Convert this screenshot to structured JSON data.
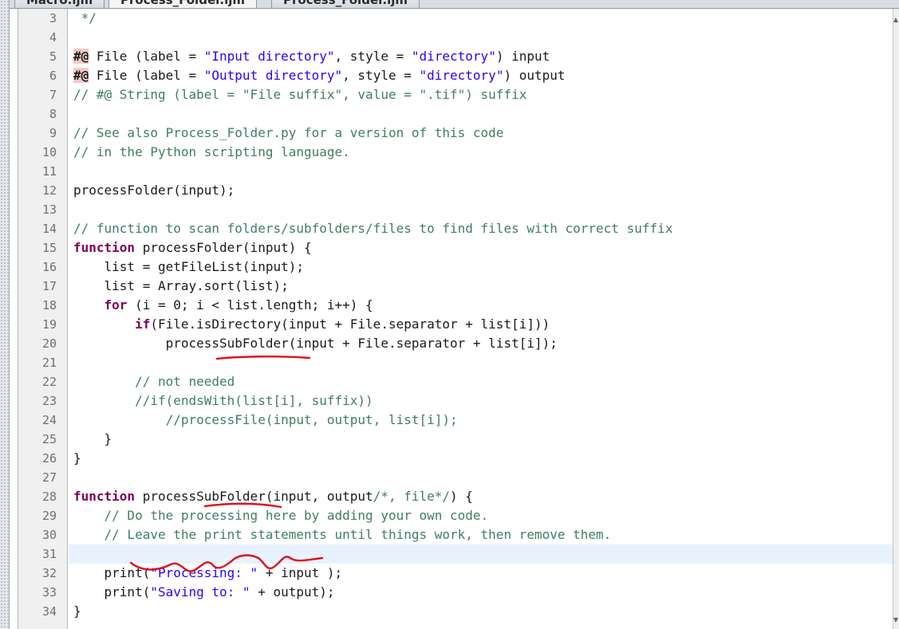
{
  "tabs": [
    {
      "label": "Macro.ijm",
      "active": false
    },
    {
      "label": "Process_Folder.ijm",
      "active": true
    },
    {
      "label": "Process_Folder.ijm",
      "active": false
    }
  ],
  "editor": {
    "current_line": 31,
    "lines": [
      {
        "n": "3",
        "tokens": [
          {
            "t": " */",
            "c": "cmt"
          }
        ]
      },
      {
        "n": "4",
        "tokens": []
      },
      {
        "n": "5",
        "tokens": [
          {
            "t": "#@",
            "c": "ann"
          },
          {
            "t": " File (label = ",
            "c": "txt"
          },
          {
            "t": "\"Input directory\"",
            "c": "str"
          },
          {
            "t": ", style = ",
            "c": "txt"
          },
          {
            "t": "\"directory\"",
            "c": "str"
          },
          {
            "t": ") input",
            "c": "txt"
          }
        ]
      },
      {
        "n": "6",
        "tokens": [
          {
            "t": "#@",
            "c": "ann"
          },
          {
            "t": " File (label = ",
            "c": "txt"
          },
          {
            "t": "\"Output directory\"",
            "c": "str"
          },
          {
            "t": ", style = ",
            "c": "txt"
          },
          {
            "t": "\"directory\"",
            "c": "str"
          },
          {
            "t": ") output",
            "c": "txt"
          }
        ]
      },
      {
        "n": "7",
        "tokens": [
          {
            "t": "// #@ String (label = \"File suffix\", value = \".tif\") suffix",
            "c": "cmt"
          }
        ]
      },
      {
        "n": "8",
        "tokens": []
      },
      {
        "n": "9",
        "tokens": [
          {
            "t": "// See also Process_Folder.py for a version of this code",
            "c": "cmt"
          }
        ]
      },
      {
        "n": "10",
        "tokens": [
          {
            "t": "// in the Python scripting language.",
            "c": "cmt"
          }
        ]
      },
      {
        "n": "11",
        "tokens": []
      },
      {
        "n": "12",
        "tokens": [
          {
            "t": "processFolder(input);",
            "c": "txt"
          }
        ]
      },
      {
        "n": "13",
        "tokens": []
      },
      {
        "n": "14",
        "tokens": [
          {
            "t": "// function to scan folders/subfolders/files to find files with correct suffix",
            "c": "cmt"
          }
        ]
      },
      {
        "n": "15",
        "tokens": [
          {
            "t": "function",
            "c": "kw"
          },
          {
            "t": " processFolder(input) {",
            "c": "txt"
          }
        ]
      },
      {
        "n": "16",
        "tokens": [
          {
            "t": "    list = getFileList(input);",
            "c": "txt"
          }
        ]
      },
      {
        "n": "17",
        "tokens": [
          {
            "t": "    list = Array.sort(list);",
            "c": "txt"
          }
        ]
      },
      {
        "n": "18",
        "tokens": [
          {
            "t": "    ",
            "c": "txt"
          },
          {
            "t": "for",
            "c": "kw"
          },
          {
            "t": " (i = 0; i < list.length; i++) {",
            "c": "txt"
          }
        ]
      },
      {
        "n": "19",
        "tokens": [
          {
            "t": "        ",
            "c": "txt"
          },
          {
            "t": "if",
            "c": "kw"
          },
          {
            "t": "(File.isDirectory(input + File.separator + list[i]))",
            "c": "txt"
          }
        ]
      },
      {
        "n": "20",
        "tokens": [
          {
            "t": "            processSubFolder(input + File.separator + list[i]);",
            "c": "txt"
          }
        ]
      },
      {
        "n": "21",
        "tokens": []
      },
      {
        "n": "22",
        "tokens": [
          {
            "t": "        // not needed",
            "c": "cmt"
          }
        ]
      },
      {
        "n": "23",
        "tokens": [
          {
            "t": "        //if(endsWith(list[i], suffix))",
            "c": "cmt"
          }
        ]
      },
      {
        "n": "24",
        "tokens": [
          {
            "t": "            //processFile(input, output, list[i]);",
            "c": "cmt"
          }
        ]
      },
      {
        "n": "25",
        "tokens": [
          {
            "t": "    }",
            "c": "txt"
          }
        ]
      },
      {
        "n": "26",
        "tokens": [
          {
            "t": "}",
            "c": "txt"
          }
        ]
      },
      {
        "n": "27",
        "tokens": []
      },
      {
        "n": "28",
        "tokens": [
          {
            "t": "function",
            "c": "kw"
          },
          {
            "t": " processSubFolder(input, output",
            "c": "txt"
          },
          {
            "t": "/*, file*/",
            "c": "cmt"
          },
          {
            "t": ") {",
            "c": "txt"
          }
        ]
      },
      {
        "n": "29",
        "tokens": [
          {
            "t": "    // Do the processing here by adding your own code.",
            "c": "cmt"
          }
        ]
      },
      {
        "n": "30",
        "tokens": [
          {
            "t": "    // Leave the print statements until things work, then remove them.",
            "c": "cmt"
          }
        ]
      },
      {
        "n": "31",
        "tokens": []
      },
      {
        "n": "32",
        "tokens": [
          {
            "t": "    print(",
            "c": "txt"
          },
          {
            "t": "\"Processing: \"",
            "c": "str"
          },
          {
            "t": " + input );",
            "c": "txt"
          }
        ]
      },
      {
        "n": "33",
        "tokens": [
          {
            "t": "    print(",
            "c": "txt"
          },
          {
            "t": "\"Saving to: \"",
            "c": "str"
          },
          {
            "t": " + output);",
            "c": "txt"
          }
        ]
      },
      {
        "n": "34",
        "tokens": [
          {
            "t": "}",
            "c": "txt"
          }
        ]
      }
    ]
  },
  "colors": {
    "keyword": "#7f0055",
    "string": "#2a00ff",
    "comment": "#3f7f5f",
    "annotation_bg": "#f6c9c9",
    "current_line_bg": "#e8f2fe",
    "ink_annotation": "#e0101a"
  },
  "icons": {
    "scroll_up": "▲",
    "scroll_down": "▼"
  }
}
